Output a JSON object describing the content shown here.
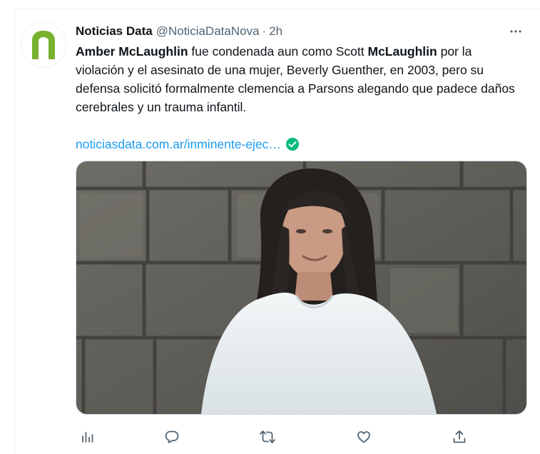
{
  "tweet": {
    "author_name": "Noticias Data",
    "author_handle": "@NoticiaDataNova",
    "separator": "·",
    "time": "2h",
    "more_label": "···",
    "text_parts": [
      {
        "text": "Amber McLaughlin",
        "bold": true
      },
      {
        "text": " fue condenada aun como Scott ",
        "bold": false
      },
      {
        "text": "McLaughlin",
        "bold": true
      },
      {
        "text": " por la violación y el asesinato de una mujer, Beverly Guenther, en 2003, pero su defensa solicitó formalmente clemencia a Parsons alegando que padece daños cerebrales y un trauma infantil.",
        "bold": false
      }
    ],
    "link_text": "noticiasdata.com.ar/inminente-ejec…",
    "icons": {
      "avatar": "noticias-data-logo",
      "verified": "verified-check-icon",
      "more": "more-options-icon",
      "media": "photo-woman-white-shirt-stone-wall"
    },
    "actions": [
      {
        "name": "views",
        "icon": "analytics-icon"
      },
      {
        "name": "reply",
        "icon": "reply-icon"
      },
      {
        "name": "retweet",
        "icon": "retweet-icon"
      },
      {
        "name": "like",
        "icon": "like-icon"
      },
      {
        "name": "share",
        "icon": "share-icon"
      }
    ],
    "colors": {
      "brand_logo": "#79b22f",
      "link": "#1d9bf0",
      "verified": "#00ba7c",
      "secondary_text": "#536471"
    }
  }
}
